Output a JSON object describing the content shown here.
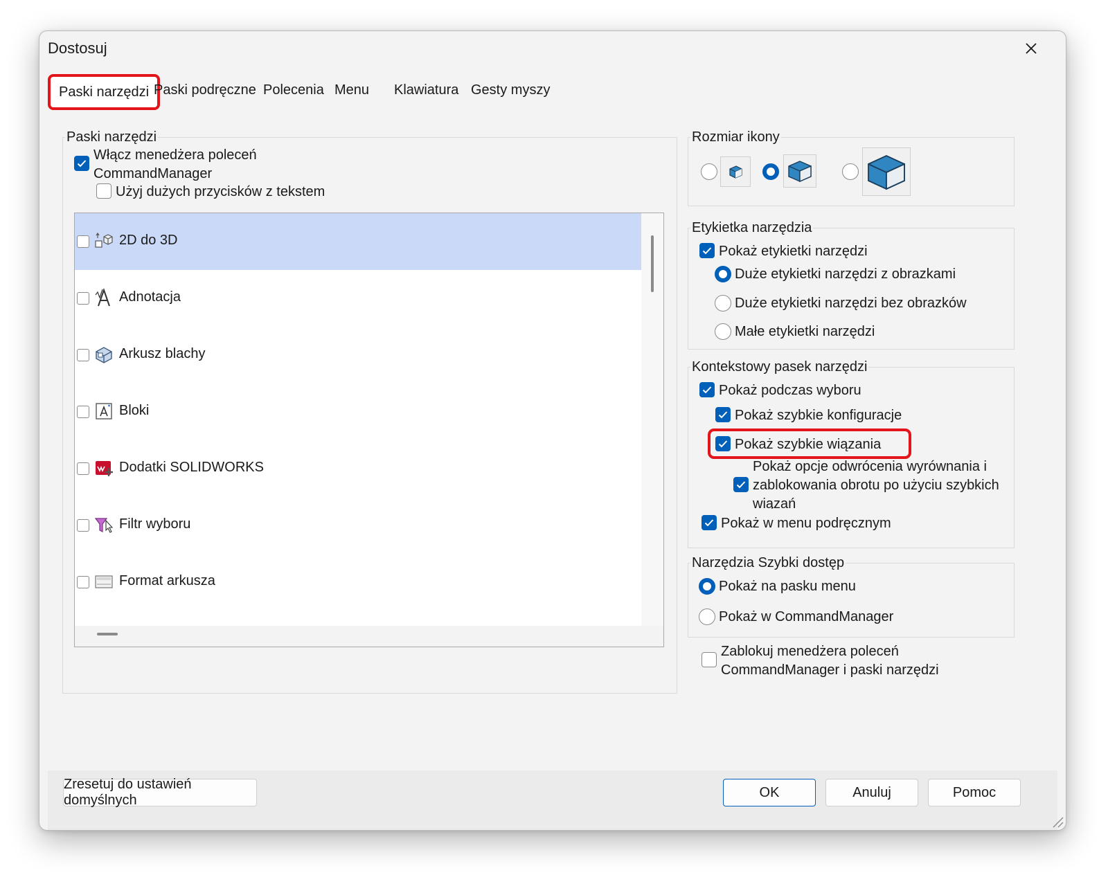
{
  "dialog": {
    "title": "Dostosuj",
    "tabs": [
      {
        "label": "Paski narzędzi",
        "active": true
      },
      {
        "label": "Paski podręczne"
      },
      {
        "label": "Polecenia"
      },
      {
        "label": "Menu"
      },
      {
        "label": "Klawiatura"
      },
      {
        "label": "Gesty myszy"
      }
    ]
  },
  "toolbars": {
    "group_label": "Paski narzędzi",
    "enable_cm_label_line1": "Włącz menedżera poleceń",
    "enable_cm_label_line2": "CommandManager",
    "enable_cm_checked": true,
    "large_buttons_label": "Użyj dużych przycisków z tekstem",
    "large_buttons_checked": false,
    "items": [
      {
        "label": "2D do 3D",
        "checked": false,
        "selected": true,
        "icon": "2d-to-3d-icon"
      },
      {
        "label": "Adnotacja",
        "checked": false,
        "icon": "annotation-icon"
      },
      {
        "label": "Arkusz blachy",
        "checked": false,
        "icon": "sheet-metal-icon"
      },
      {
        "label": "Bloki",
        "checked": false,
        "icon": "blocks-icon"
      },
      {
        "label": "Dodatki SOLIDWORKS",
        "checked": false,
        "icon": "solidworks-addins-icon"
      },
      {
        "label": "Filtr wyboru",
        "checked": false,
        "icon": "selection-filter-icon"
      },
      {
        "label": "Format arkusza",
        "checked": false,
        "icon": "sheet-format-icon"
      }
    ]
  },
  "icon_size": {
    "group_label": "Rozmiar ikony",
    "selected": "medium",
    "options": [
      "small",
      "medium",
      "large"
    ]
  },
  "tooltip": {
    "group_label": "Etykietka narzędzia",
    "show_label": "Pokaż etykietki narzędzi",
    "show_checked": true,
    "options": [
      {
        "label": "Duże etykietki narzędzi z obrazkami",
        "selected": true
      },
      {
        "label": "Duże etykietki narzędzi bez obrazków",
        "selected": false
      },
      {
        "label": "Małe etykietki narzędzi",
        "selected": false
      }
    ]
  },
  "context_toolbar": {
    "group_label": "Kontekstowy pasek narzędzi",
    "show_on_selection": "Pokaż podczas wyboru",
    "quick_configs": "Pokaż szybkie konfiguracje",
    "quick_mates": "Pokaż szybkie wiązania",
    "flip_line1": "Pokaż opcje odwrócenia wyrównania i",
    "flip_line2": "zablokowania obrotu po użyciu szybkich",
    "flip_line3": "wiązań",
    "shortcut_menu": "Pokaż w menu podręcznym"
  },
  "quick_access": {
    "group_label": "Narzędzia Szybki dostęp",
    "options": [
      {
        "label": "Pokaż na pasku menu",
        "selected": true
      },
      {
        "label": "Pokaż w CommandManager",
        "selected": false
      }
    ]
  },
  "lock": {
    "label_line1": "Zablokuj menedżera poleceń",
    "label_line2": "CommandManager i paski narzędzi",
    "checked": false
  },
  "footer": {
    "reset_label": "Zresetuj do ustawień domyślnych",
    "ok_label": "OK",
    "cancel_label": "Anuluj",
    "help_label": "Pomoc"
  },
  "colors": {
    "accent": "#005fb8",
    "highlight_red": "#e3151a",
    "list_selection": "#cbd9f9"
  }
}
